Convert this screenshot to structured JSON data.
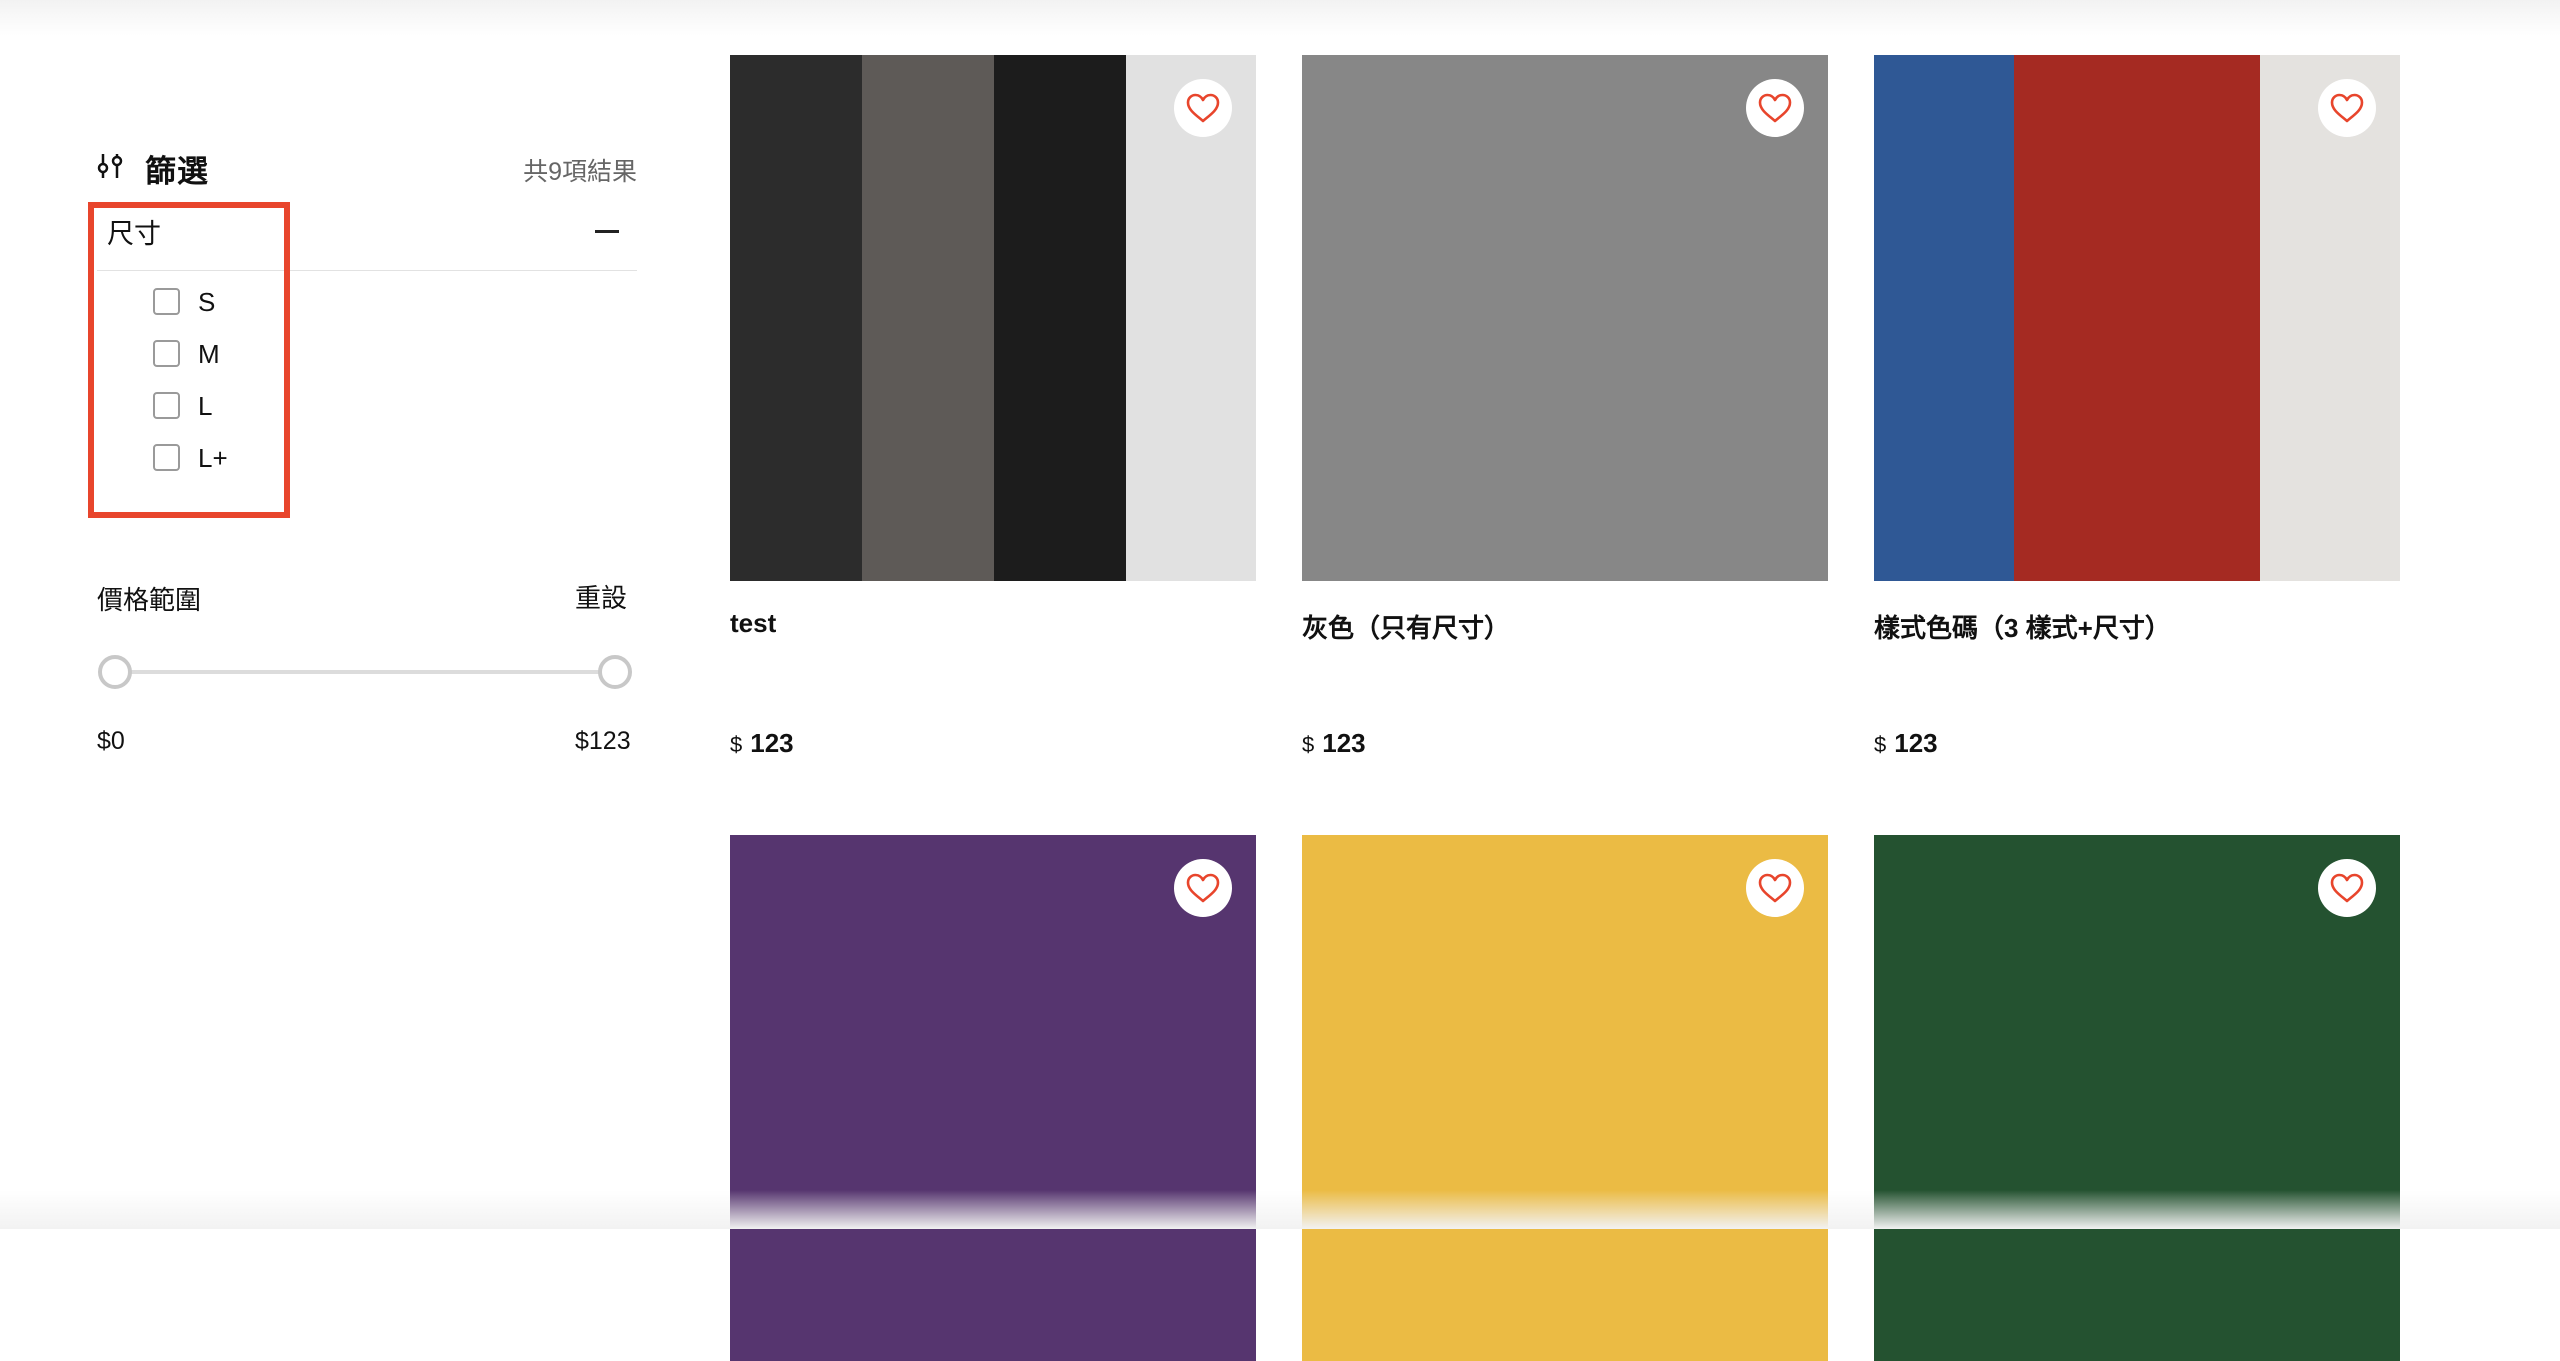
{
  "filters": {
    "title": "篩選",
    "result_count": "共9項結果",
    "size": {
      "title": "尺寸",
      "options": [
        "S",
        "M",
        "L",
        "L+"
      ]
    },
    "price": {
      "title": "價格範圍",
      "reset_label": "重設",
      "min_label": "$0",
      "max_label": "$123",
      "range_low_fraction": 0,
      "range_high_fraction": 1
    }
  },
  "products": [
    {
      "name": "test",
      "currency": "$",
      "price": "123",
      "colors": [
        "#2c2c2c",
        "#5e5a57",
        "#1c1c1c",
        "#e1e1e1"
      ],
      "favorite": false
    },
    {
      "name": "灰色（只有尺寸）",
      "currency": "$",
      "price": "123",
      "colors": [
        "#878787"
      ],
      "favorite": false
    },
    {
      "name": "樣式色碼（3 樣式+尺寸）",
      "currency": "$",
      "price": "123",
      "colors": [
        "#2f5895",
        "#a52a22",
        "#e4e2df"
      ],
      "favorite": false
    },
    {
      "name": "",
      "currency": "",
      "price": "",
      "colors": [
        "#56356f"
      ],
      "favorite": false
    },
    {
      "name": "",
      "currency": "",
      "price": "",
      "colors": [
        "#ebbb44"
      ],
      "favorite": false
    },
    {
      "name": "",
      "currency": "",
      "price": "",
      "colors": [
        "#245230"
      ],
      "favorite": false
    }
  ],
  "colors": {
    "highlight": "#e8452c",
    "heart": "#e8452c"
  }
}
